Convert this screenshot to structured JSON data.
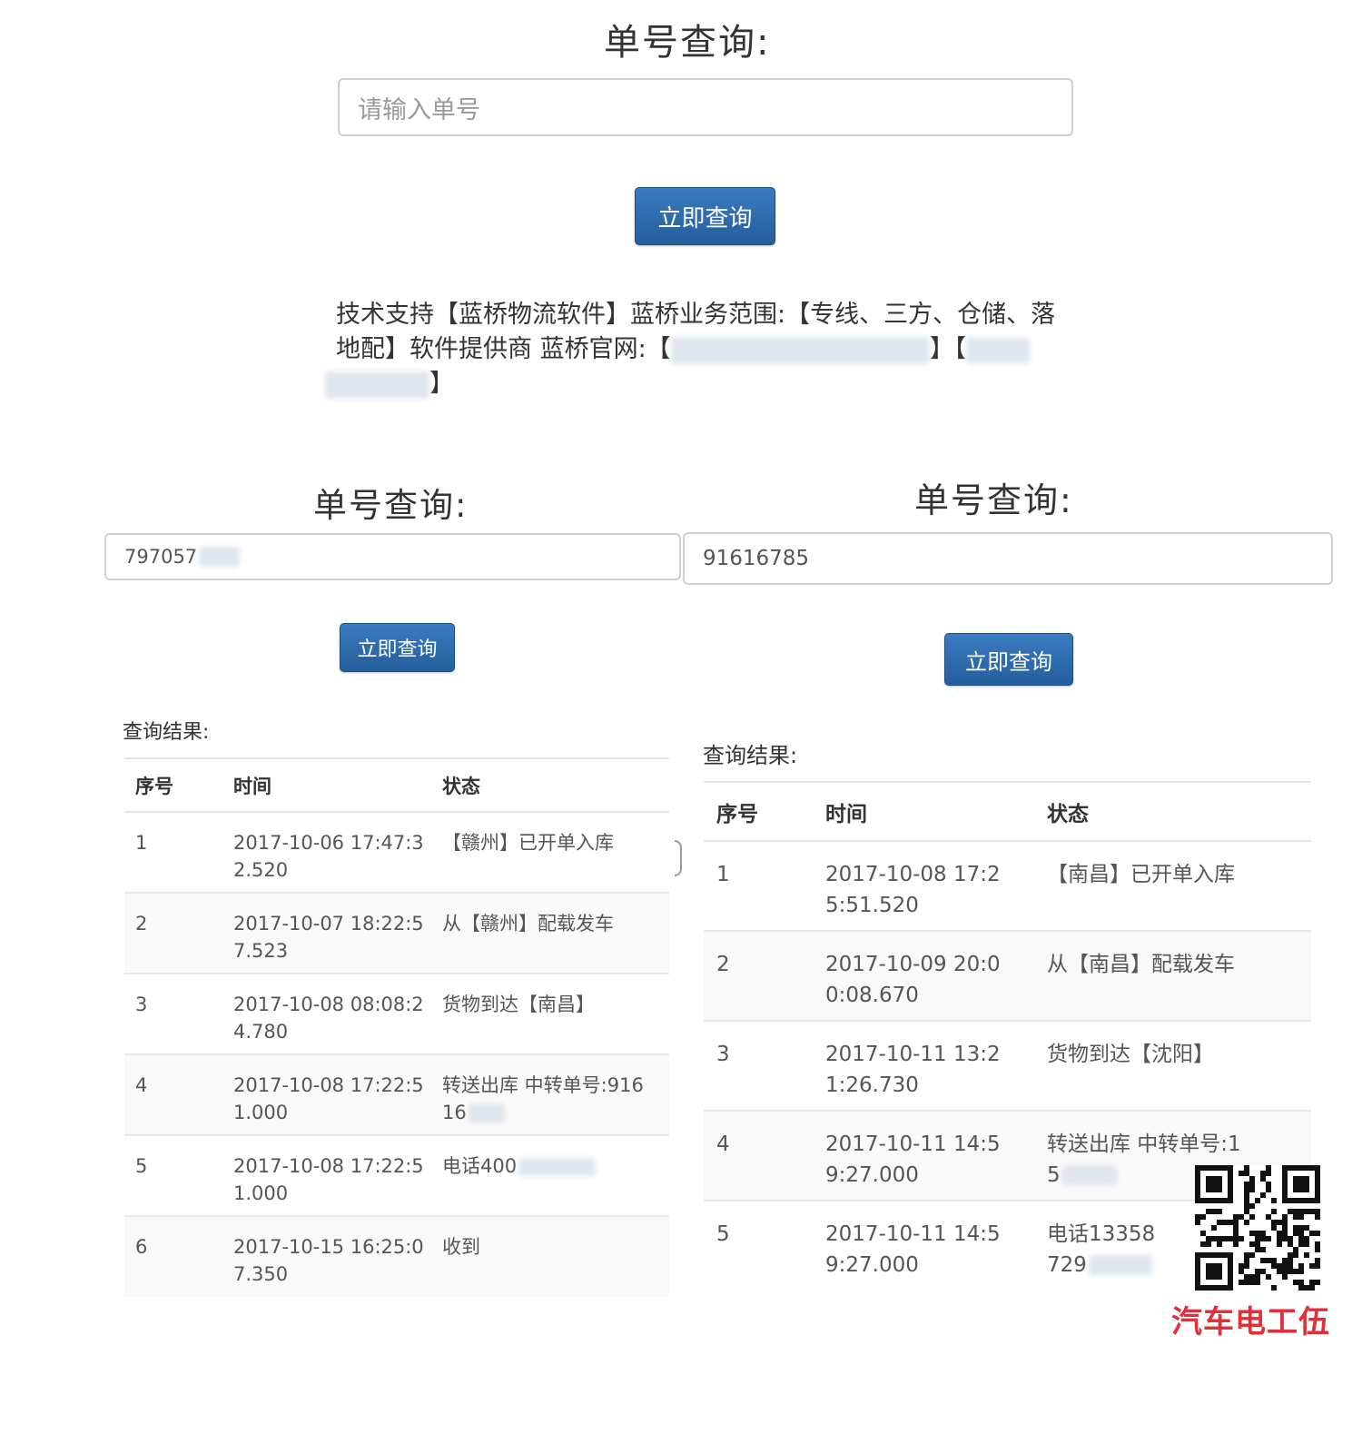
{
  "top": {
    "heading": "单号查询:",
    "input_placeholder": "请输入单号",
    "button_label": "立即查询",
    "support_line1": "技术支持【蓝桥物流软件】蓝桥业务范围:【专线、三方、仓储、落",
    "support_line2_prefix": "地配】软件提供商 蓝桥官网:【",
    "support_bracket_close": "】【",
    "support_line3_close": "】"
  },
  "left": {
    "heading": "单号查询:",
    "input_value": "797057",
    "button_label": "立即查询",
    "result_label": "查询结果:",
    "columns": [
      "序号",
      "时间",
      "状态"
    ],
    "rows": [
      {
        "no": "1",
        "time": "2017-10-06 17:47:3\n2.520",
        "status": "【赣州】已开单入库"
      },
      {
        "no": "2",
        "time": "2017-10-07 18:22:5\n7.523",
        "status": "从【赣州】配载发车"
      },
      {
        "no": "3",
        "time": "2017-10-08 08:08:2\n4.780",
        "status": "货物到达【南昌】"
      },
      {
        "no": "4",
        "time": "2017-10-08 17:22:5\n1.000",
        "status": "转送出库 中转单号:916\n16"
      },
      {
        "no": "5",
        "time": "2017-10-08 17:22:5\n1.000",
        "status": "电话400"
      },
      {
        "no": "6",
        "time": "2017-10-15 16:25:0\n7.350",
        "status": "收到"
      }
    ]
  },
  "right": {
    "heading": "单号查询:",
    "input_value": "91616785",
    "button_label": "立即查询",
    "result_label": "查询结果:",
    "columns": [
      "序号",
      "时间",
      "状态"
    ],
    "rows": [
      {
        "no": "1",
        "time": "2017-10-08 17:2\n5:51.520",
        "status": "【南昌】已开单入库"
      },
      {
        "no": "2",
        "time": "2017-10-09 20:0\n0:08.670",
        "status": "从【南昌】配载发车"
      },
      {
        "no": "3",
        "time": "2017-10-11 13:2\n1:26.730",
        "status": "货物到达【沈阳】"
      },
      {
        "no": "4",
        "time": "2017-10-11 14:5\n9:27.000",
        "status": "转送出库 中转单号:1\n5"
      },
      {
        "no": "5",
        "time": "2017-10-11 14:5\n9:27.000",
        "status": "电话13358\n729"
      }
    ]
  },
  "watermark": {
    "text": "汽车电工伍"
  },
  "colors": {
    "button": "#2a66a6",
    "watermark": "#e0313a"
  }
}
